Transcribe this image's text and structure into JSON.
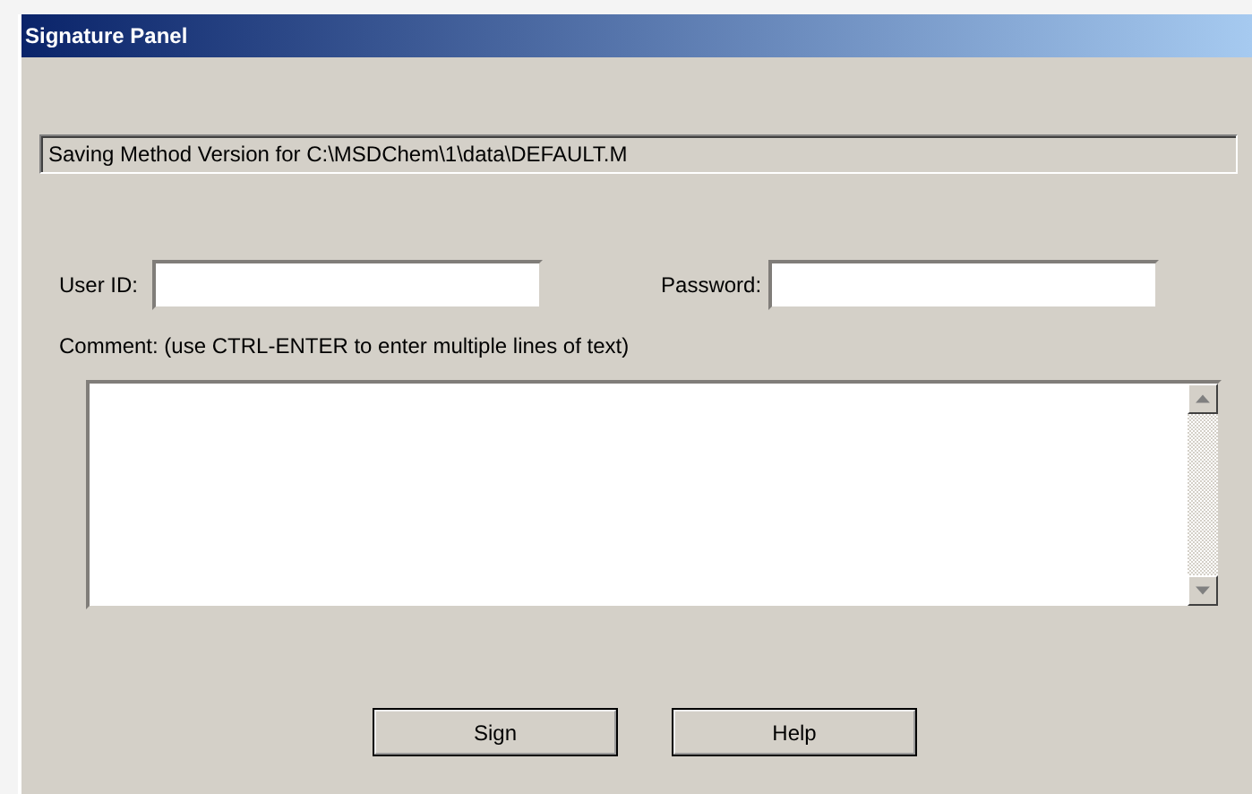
{
  "window": {
    "title": "Signature Panel"
  },
  "status": "Saving Method Version for C:\\MSDChem\\1\\data\\DEFAULT.M",
  "fields": [
    {
      "label": "User ID:"
    },
    {
      "label": "Password:"
    }
  ],
  "comment": {
    "label": "Comment: (use CTRL-ENTER to enter multiple lines of text)"
  },
  "buttons": [
    "Sign",
    "Help"
  ]
}
